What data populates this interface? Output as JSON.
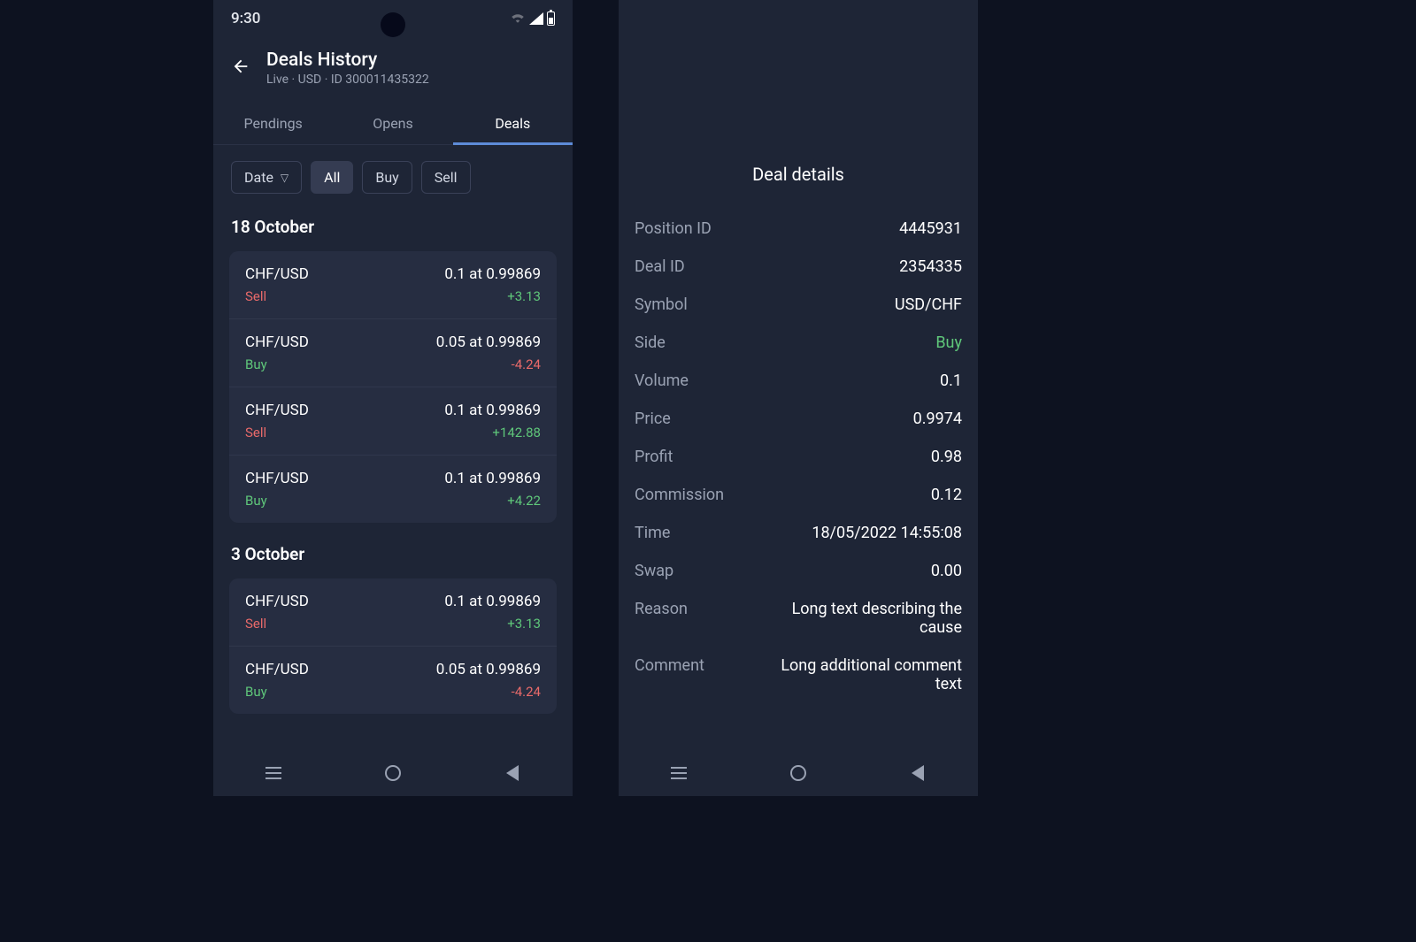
{
  "status": {
    "time": "9:30"
  },
  "header": {
    "title": "Deals History",
    "subtitle": "Live · USD · ID 300011435322"
  },
  "tabs": {
    "pendings": "Pendings",
    "opens": "Opens",
    "deals": "Deals"
  },
  "filters": {
    "date": "Date",
    "all": "All",
    "buy": "Buy",
    "sell": "Sell"
  },
  "sections": [
    {
      "title": "18 October",
      "deals": [
        {
          "symbol": "CHF/USD",
          "vol_price": "0.1 at 0.99869",
          "side": "Sell",
          "pl": "+3.13",
          "pl_sign": "pos"
        },
        {
          "symbol": "CHF/USD",
          "vol_price": "0.05 at 0.99869",
          "side": "Buy",
          "pl": "-4.24",
          "pl_sign": "neg"
        },
        {
          "symbol": "CHF/USD",
          "vol_price": "0.1 at 0.99869",
          "side": "Sell",
          "pl": "+142.88",
          "pl_sign": "pos"
        },
        {
          "symbol": "CHF/USD",
          "vol_price": "0.1 at 0.99869",
          "side": "Buy",
          "pl": "+4.22",
          "pl_sign": "pos"
        }
      ]
    },
    {
      "title": "3 October",
      "deals": [
        {
          "symbol": "CHF/USD",
          "vol_price": "0.1 at 0.99869",
          "side": "Sell",
          "pl": "+3.13",
          "pl_sign": "pos"
        },
        {
          "symbol": "CHF/USD",
          "vol_price": "0.05 at 0.99869",
          "side": "Buy",
          "pl": "-4.24",
          "pl_sign": "neg"
        }
      ]
    }
  ],
  "details": {
    "title": "Deal details",
    "rows": {
      "position_id": {
        "label": "Position ID",
        "value": "4445931"
      },
      "deal_id": {
        "label": "Deal ID",
        "value": "2354335"
      },
      "symbol": {
        "label": "Symbol",
        "value": "USD/CHF"
      },
      "side": {
        "label": "Side",
        "value": "Buy"
      },
      "volume": {
        "label": "Volume",
        "value": "0.1"
      },
      "price": {
        "label": "Price",
        "value": "0.9974"
      },
      "profit": {
        "label": "Profit",
        "value": "0.98"
      },
      "commission": {
        "label": "Commission",
        "value": "0.12"
      },
      "time": {
        "label": "Time",
        "value": "18/05/2022 14:55:08"
      },
      "swap": {
        "label": "Swap",
        "value": "0.00"
      },
      "reason": {
        "label": "Reason",
        "value": "Long text describing the cause"
      },
      "comment": {
        "label": "Comment",
        "value": "Long additional comment text"
      }
    }
  }
}
